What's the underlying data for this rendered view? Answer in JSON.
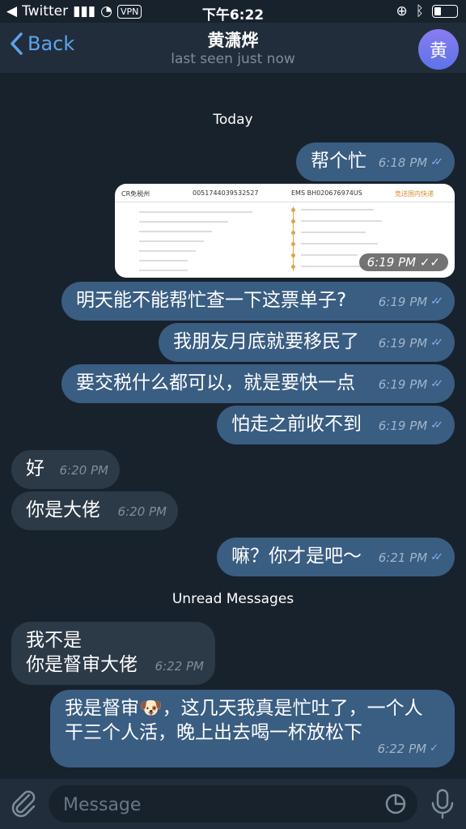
{
  "status": {
    "app": "Twitter",
    "vpn": "VPN",
    "time": "下午6:22"
  },
  "header": {
    "back": "Back",
    "title": "黄潇烨",
    "subtitle": "last seen just now",
    "avatar": "黄"
  },
  "date_separator": "Today",
  "unread_separator": "Unread Messages",
  "messages": [
    {
      "dir": "out",
      "text": "帮个忙",
      "time": "6:18 PM"
    },
    {
      "dir": "out",
      "type": "image",
      "time": "6:19 PM"
    },
    {
      "dir": "out",
      "text": "明天能不能帮忙查一下这票单子?",
      "time": "6:19 PM"
    },
    {
      "dir": "out",
      "text": "我朋友月底就要移民了",
      "time": "6:19 PM"
    },
    {
      "dir": "out",
      "text": "要交税什么都可以，就是要快一点",
      "time": "6:19 PM"
    },
    {
      "dir": "out",
      "text": "怕走之前收不到",
      "time": "6:19 PM"
    },
    {
      "dir": "in",
      "text": "好",
      "time": "6:20 PM"
    },
    {
      "dir": "in",
      "text": "你是大佬",
      "time": "6:20 PM"
    },
    {
      "dir": "out",
      "text": "嘛？你才是吧～",
      "time": "6:21 PM"
    },
    {
      "dir": "in",
      "line1": "我不是",
      "line2": "你是督审大佬",
      "time": "6:22 PM"
    },
    {
      "dir": "out",
      "line1": "我是督审🐶，这几天我真是忙吐了，一个人",
      "line2": "干三个人活，晚上出去喝一杯放松下",
      "time": "6:22 PM"
    }
  ],
  "image_doc": {
    "origin": "CR免税州",
    "number": "0051744039532527",
    "ems": "EMS BH020676974US",
    "carrier": "竞送国内快递"
  },
  "input": {
    "placeholder": "Message"
  }
}
